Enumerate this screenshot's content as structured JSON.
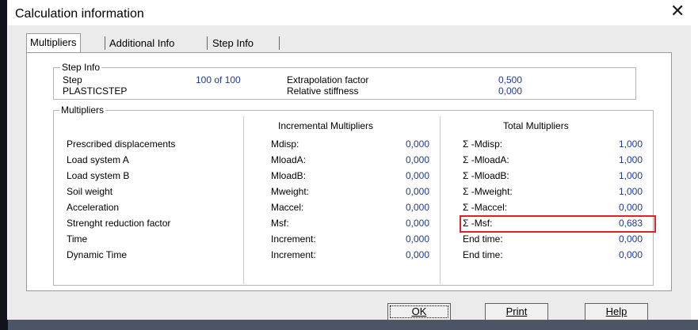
{
  "window": {
    "title": "Calculation information"
  },
  "tabs": [
    {
      "label": "Multipliers",
      "active": true
    },
    {
      "label": "Additional Info",
      "active": false
    },
    {
      "label": "Step Info",
      "active": false
    }
  ],
  "step_info": {
    "legend": "Step Info",
    "step_label": "Step",
    "step_value": "100 of 100",
    "step_type": "PLASTICSTEP",
    "extrapolation_label": "Extrapolation factor",
    "extrapolation_value": "0,500",
    "stiffness_label": "Relative stiffness",
    "stiffness_value": "0,000"
  },
  "multipliers": {
    "legend": "Multipliers",
    "incremental_header": "Incremental Multipliers",
    "total_header": "Total Multipliers",
    "rows": [
      {
        "label": "Prescribed displacements",
        "inc_name": "Mdisp:",
        "inc_value": "0,000",
        "tot_name": "Σ -Mdisp:",
        "tot_value": "1,000"
      },
      {
        "label": "Load system A",
        "inc_name": "MloadA:",
        "inc_value": "0,000",
        "tot_name": "Σ -MloadA:",
        "tot_value": "1,000"
      },
      {
        "label": "Load system B",
        "inc_name": "MloadB:",
        "inc_value": "0,000",
        "tot_name": "Σ -MloadB:",
        "tot_value": "1,000"
      },
      {
        "label": "Soil weight",
        "inc_name": "Mweight:",
        "inc_value": "0,000",
        "tot_name": "Σ -Mweight:",
        "tot_value": "1,000"
      },
      {
        "label": "Acceleration",
        "inc_name": "Maccel:",
        "inc_value": "0,000",
        "tot_name": "Σ -Maccel:",
        "tot_value": "0,000"
      },
      {
        "label": "Strenght reduction factor",
        "inc_name": "Msf:",
        "inc_value": "0,000",
        "tot_name": "Σ -Msf:",
        "tot_value": "0,683"
      },
      {
        "label": "Time",
        "inc_name": "Increment:",
        "inc_value": "0,000",
        "tot_name": "End time:",
        "tot_value": "0,000"
      },
      {
        "label": "Dynamic Time",
        "inc_name": "Increment:",
        "inc_value": "0,000",
        "tot_name": "End time:",
        "tot_value": "0,000"
      }
    ]
  },
  "buttons": {
    "ok": "OK",
    "print": "Print",
    "help": "Help"
  },
  "colors": {
    "value_text": "#1f3a8f",
    "highlight": "#e0202a"
  }
}
